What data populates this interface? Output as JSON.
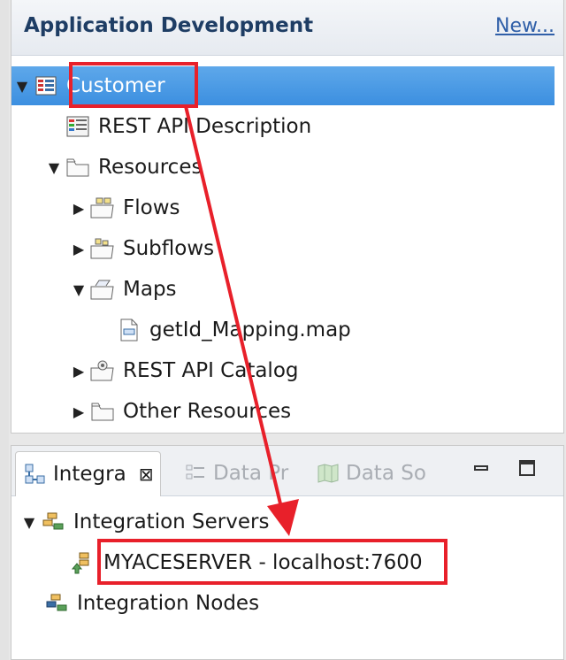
{
  "app_dev": {
    "title": "Application Development",
    "new_link": "New...",
    "tree": {
      "customer": "Customer",
      "rest_api_description": "REST API Description",
      "resources": "Resources",
      "flows": "Flows",
      "subflows": "Subflows",
      "maps": "Maps",
      "getid_map": "getId_Mapping.map",
      "rest_api_catalog": "REST API Catalog",
      "other_resources": "Other Resources"
    }
  },
  "bottom": {
    "tabs": [
      "Integra",
      "Data Pr",
      "Data So"
    ],
    "tree": {
      "integration_servers": "Integration Servers",
      "server": "MYACESERVER - localhost:7600",
      "integration_nodes": "Integration Nodes"
    }
  },
  "icons": {
    "expanded": "triangle-down-icon",
    "collapsed": "triangle-right-icon",
    "application": "application-icon",
    "rest_api": "rest-api-icon",
    "folder": "folder-icon",
    "flow_folder": "flow-folder-icon",
    "map_folder": "map-folder-icon",
    "map_file": "map-file-icon",
    "catalog": "catalog-icon",
    "integration": "integration-icon",
    "server": "server-icon",
    "close": "close-icon",
    "minimize": "minimize-icon",
    "maximize": "maximize-icon"
  },
  "colors": {
    "selection": "#3c8fe0",
    "annotation": "#e8202a",
    "link": "#2f5fa8",
    "title": "#1e3d64"
  }
}
